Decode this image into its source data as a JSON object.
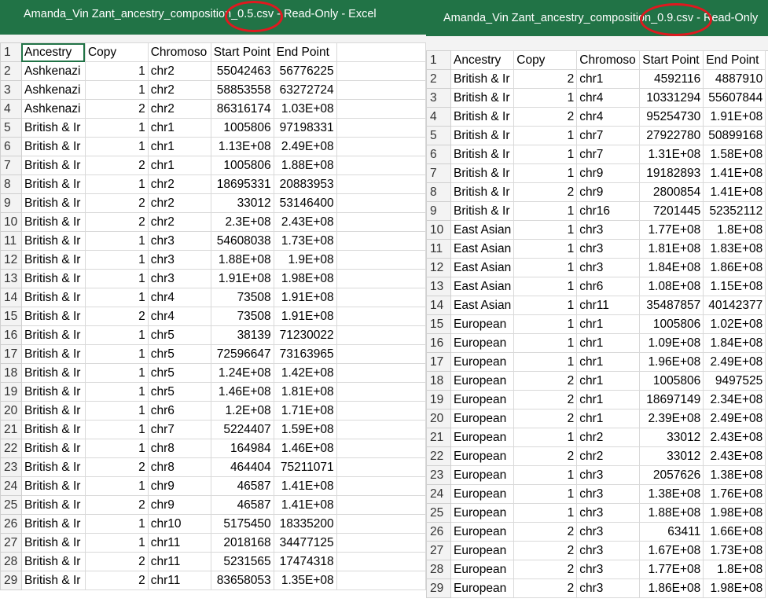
{
  "left_window": {
    "title": "Amanda_Vin Zant_ancestry_composition_0.5.csv  -  Read-Only  -  Excel",
    "rows": [
      {
        "n": "1",
        "a": "Ancestry",
        "b": "Copy",
        "c": "Chromoso",
        "d": "Start Point",
        "e": "End Point"
      },
      {
        "n": "2",
        "a": "Ashkenazi",
        "b": "1",
        "c": "chr2",
        "d": "55042463",
        "e": "56776225"
      },
      {
        "n": "3",
        "a": "Ashkenazi",
        "b": "1",
        "c": "chr2",
        "d": "58853558",
        "e": "63272724"
      },
      {
        "n": "4",
        "a": "Ashkenazi",
        "b": "2",
        "c": "chr2",
        "d": "86316174",
        "e": "1.03E+08"
      },
      {
        "n": "5",
        "a": "British & Ir",
        "b": "1",
        "c": "chr1",
        "d": "1005806",
        "e": "97198331"
      },
      {
        "n": "6",
        "a": "British & Ir",
        "b": "1",
        "c": "chr1",
        "d": "1.13E+08",
        "e": "2.49E+08"
      },
      {
        "n": "7",
        "a": "British & Ir",
        "b": "2",
        "c": "chr1",
        "d": "1005806",
        "e": "1.88E+08"
      },
      {
        "n": "8",
        "a": "British & Ir",
        "b": "1",
        "c": "chr2",
        "d": "18695331",
        "e": "20883953"
      },
      {
        "n": "9",
        "a": "British & Ir",
        "b": "2",
        "c": "chr2",
        "d": "33012",
        "e": "53146400"
      },
      {
        "n": "10",
        "a": "British & Ir",
        "b": "2",
        "c": "chr2",
        "d": "2.3E+08",
        "e": "2.43E+08"
      },
      {
        "n": "11",
        "a": "British & Ir",
        "b": "1",
        "c": "chr3",
        "d": "54608038",
        "e": "1.73E+08"
      },
      {
        "n": "12",
        "a": "British & Ir",
        "b": "1",
        "c": "chr3",
        "d": "1.88E+08",
        "e": "1.9E+08"
      },
      {
        "n": "13",
        "a": "British & Ir",
        "b": "1",
        "c": "chr3",
        "d": "1.91E+08",
        "e": "1.98E+08"
      },
      {
        "n": "14",
        "a": "British & Ir",
        "b": "1",
        "c": "chr4",
        "d": "73508",
        "e": "1.91E+08"
      },
      {
        "n": "15",
        "a": "British & Ir",
        "b": "2",
        "c": "chr4",
        "d": "73508",
        "e": "1.91E+08"
      },
      {
        "n": "16",
        "a": "British & Ir",
        "b": "1",
        "c": "chr5",
        "d": "38139",
        "e": "71230022"
      },
      {
        "n": "17",
        "a": "British & Ir",
        "b": "1",
        "c": "chr5",
        "d": "72596647",
        "e": "73163965"
      },
      {
        "n": "18",
        "a": "British & Ir",
        "b": "1",
        "c": "chr5",
        "d": "1.24E+08",
        "e": "1.42E+08"
      },
      {
        "n": "19",
        "a": "British & Ir",
        "b": "1",
        "c": "chr5",
        "d": "1.46E+08",
        "e": "1.81E+08"
      },
      {
        "n": "20",
        "a": "British & Ir",
        "b": "1",
        "c": "chr6",
        "d": "1.2E+08",
        "e": "1.71E+08"
      },
      {
        "n": "21",
        "a": "British & Ir",
        "b": "1",
        "c": "chr7",
        "d": "5224407",
        "e": "1.59E+08"
      },
      {
        "n": "22",
        "a": "British & Ir",
        "b": "1",
        "c": "chr8",
        "d": "164984",
        "e": "1.46E+08"
      },
      {
        "n": "23",
        "a": "British & Ir",
        "b": "2",
        "c": "chr8",
        "d": "464404",
        "e": "75211071"
      },
      {
        "n": "24",
        "a": "British & Ir",
        "b": "1",
        "c": "chr9",
        "d": "46587",
        "e": "1.41E+08"
      },
      {
        "n": "25",
        "a": "British & Ir",
        "b": "2",
        "c": "chr9",
        "d": "46587",
        "e": "1.41E+08"
      },
      {
        "n": "26",
        "a": "British & Ir",
        "b": "1",
        "c": "chr10",
        "d": "5175450",
        "e": "18335200"
      },
      {
        "n": "27",
        "a": "British & Ir",
        "b": "1",
        "c": "chr11",
        "d": "2018168",
        "e": "34477125"
      },
      {
        "n": "28",
        "a": "British & Ir",
        "b": "2",
        "c": "chr11",
        "d": "5231565",
        "e": "17474318"
      },
      {
        "n": "29",
        "a": "British & Ir",
        "b": "2",
        "c": "chr11",
        "d": "83658053",
        "e": "1.35E+08"
      }
    ]
  },
  "right_window": {
    "title": "Amanda_Vin Zant_ancestry_composition_0.9.csv  -  Read-Only",
    "rows": [
      {
        "n": "1",
        "a": "Ancestry",
        "b": "Copy",
        "c": "Chromoso",
        "d": "Start Point",
        "e": "End Point"
      },
      {
        "n": "2",
        "a": "British & Ir",
        "b": "2",
        "c": "chr1",
        "d": "4592116",
        "e": "4887910"
      },
      {
        "n": "3",
        "a": "British & Ir",
        "b": "1",
        "c": "chr4",
        "d": "10331294",
        "e": "55607844"
      },
      {
        "n": "4",
        "a": "British & Ir",
        "b": "2",
        "c": "chr4",
        "d": "95254730",
        "e": "1.91E+08"
      },
      {
        "n": "5",
        "a": "British & Ir",
        "b": "1",
        "c": "chr7",
        "d": "27922780",
        "e": "50899168"
      },
      {
        "n": "6",
        "a": "British & Ir",
        "b": "1",
        "c": "chr7",
        "d": "1.31E+08",
        "e": "1.58E+08"
      },
      {
        "n": "7",
        "a": "British & Ir",
        "b": "1",
        "c": "chr9",
        "d": "19182893",
        "e": "1.41E+08"
      },
      {
        "n": "8",
        "a": "British & Ir",
        "b": "2",
        "c": "chr9",
        "d": "2800854",
        "e": "1.41E+08"
      },
      {
        "n": "9",
        "a": "British & Ir",
        "b": "1",
        "c": "chr16",
        "d": "7201445",
        "e": "52352112"
      },
      {
        "n": "10",
        "a": "East Asian",
        "b": "1",
        "c": "chr3",
        "d": "1.77E+08",
        "e": "1.8E+08"
      },
      {
        "n": "11",
        "a": "East Asian",
        "b": "1",
        "c": "chr3",
        "d": "1.81E+08",
        "e": "1.83E+08"
      },
      {
        "n": "12",
        "a": "East Asian",
        "b": "1",
        "c": "chr3",
        "d": "1.84E+08",
        "e": "1.86E+08"
      },
      {
        "n": "13",
        "a": "East Asian",
        "b": "1",
        "c": "chr6",
        "d": "1.08E+08",
        "e": "1.15E+08"
      },
      {
        "n": "14",
        "a": "East Asian",
        "b": "1",
        "c": "chr11",
        "d": "35487857",
        "e": "40142377"
      },
      {
        "n": "15",
        "a": "European",
        "b": "1",
        "c": "chr1",
        "d": "1005806",
        "e": "1.02E+08"
      },
      {
        "n": "16",
        "a": "European",
        "b": "1",
        "c": "chr1",
        "d": "1.09E+08",
        "e": "1.84E+08"
      },
      {
        "n": "17",
        "a": "European",
        "b": "1",
        "c": "chr1",
        "d": "1.96E+08",
        "e": "2.49E+08"
      },
      {
        "n": "18",
        "a": "European",
        "b": "2",
        "c": "chr1",
        "d": "1005806",
        "e": "9497525"
      },
      {
        "n": "19",
        "a": "European",
        "b": "2",
        "c": "chr1",
        "d": "18697149",
        "e": "2.34E+08"
      },
      {
        "n": "20",
        "a": "European",
        "b": "2",
        "c": "chr1",
        "d": "2.39E+08",
        "e": "2.49E+08"
      },
      {
        "n": "21",
        "a": "European",
        "b": "1",
        "c": "chr2",
        "d": "33012",
        "e": "2.43E+08"
      },
      {
        "n": "22",
        "a": "European",
        "b": "2",
        "c": "chr2",
        "d": "33012",
        "e": "2.43E+08"
      },
      {
        "n": "23",
        "a": "European",
        "b": "1",
        "c": "chr3",
        "d": "2057626",
        "e": "1.38E+08"
      },
      {
        "n": "24",
        "a": "European",
        "b": "1",
        "c": "chr3",
        "d": "1.38E+08",
        "e": "1.76E+08"
      },
      {
        "n": "25",
        "a": "European",
        "b": "1",
        "c": "chr3",
        "d": "1.88E+08",
        "e": "1.98E+08"
      },
      {
        "n": "26",
        "a": "European",
        "b": "2",
        "c": "chr3",
        "d": "63411",
        "e": "1.66E+08"
      },
      {
        "n": "27",
        "a": "European",
        "b": "2",
        "c": "chr3",
        "d": "1.67E+08",
        "e": "1.73E+08"
      },
      {
        "n": "28",
        "a": "European",
        "b": "2",
        "c": "chr3",
        "d": "1.77E+08",
        "e": "1.8E+08"
      },
      {
        "n": "29",
        "a": "European",
        "b": "2",
        "c": "chr3",
        "d": "1.86E+08",
        "e": "1.98E+08"
      }
    ]
  },
  "colors": {
    "excel_green": "#217346",
    "highlight_red": "#e0191f"
  }
}
